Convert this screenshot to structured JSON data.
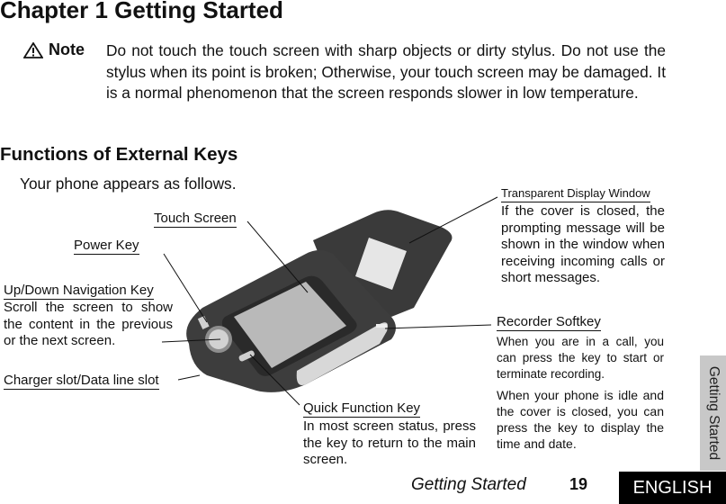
{
  "chapter_title": "Chapter 1 Getting Started",
  "note": {
    "icon": "warning-triangle-icon",
    "label": "Note",
    "text": "Do not touch the touch screen with sharp objects or dirty stylus. Do not use the stylus when its point is broken; Otherwise, your touch screen may be damaged. It is a normal phenomenon that the screen responds slower in low temperature."
  },
  "section_title": "Functions of External Keys",
  "intro": "Your phone appears as follows.",
  "callouts": {
    "touch_screen": {
      "label": "Touch Screen"
    },
    "power_key": {
      "label": "Power Key"
    },
    "nav_key": {
      "label": "Up/Down Navigation Key",
      "desc": "Scroll the screen to show the content in the previous or the next screen."
    },
    "charger_slot": {
      "label": "Charger slot/Data line slot"
    },
    "quick_function": {
      "label": "Quick Function Key",
      "desc": "In most screen status, press the key to return to the main screen."
    },
    "display_window": {
      "label": "Transparent Display Window",
      "desc": "If the cover is closed, the prompting message will be shown in the window when receiving incoming calls or short messages."
    },
    "recorder": {
      "label": "Recorder Softkey",
      "desc1": "When you are in a call, you can press the key to start or terminate recording.",
      "desc2": "When your phone is idle and the cover is closed, you can press the key to display the time and date."
    }
  },
  "side_tab": "Getting Started",
  "footer": {
    "section": "Getting Started",
    "page": "19",
    "language": "ENGLISH"
  }
}
